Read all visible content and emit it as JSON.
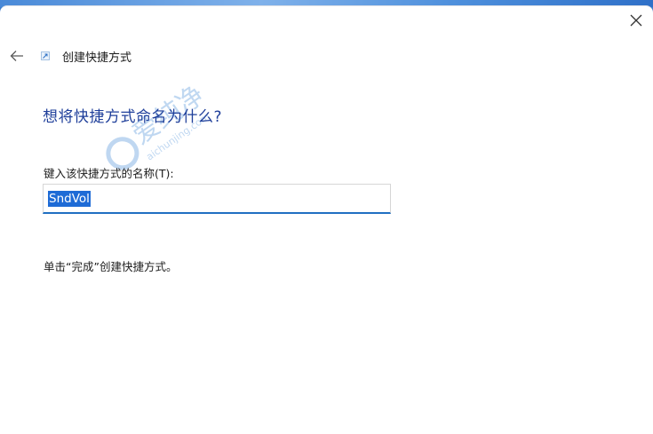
{
  "window": {
    "title": "创建快捷方式",
    "close_icon": "close-icon",
    "back_icon": "back-arrow-icon"
  },
  "page": {
    "heading": "想将快捷方式命名为什么?",
    "field_label": "键入该快捷方式的名称(T):",
    "name_value": "SndVol",
    "instruction": "单击“完成”创建快捷方式。"
  },
  "watermark": {
    "text": "爱纯净",
    "url": "aichunjing.com"
  },
  "colors": {
    "heading": "#1f3f9a",
    "accent": "#1f6fc2",
    "selection": "#1e6bd6"
  }
}
